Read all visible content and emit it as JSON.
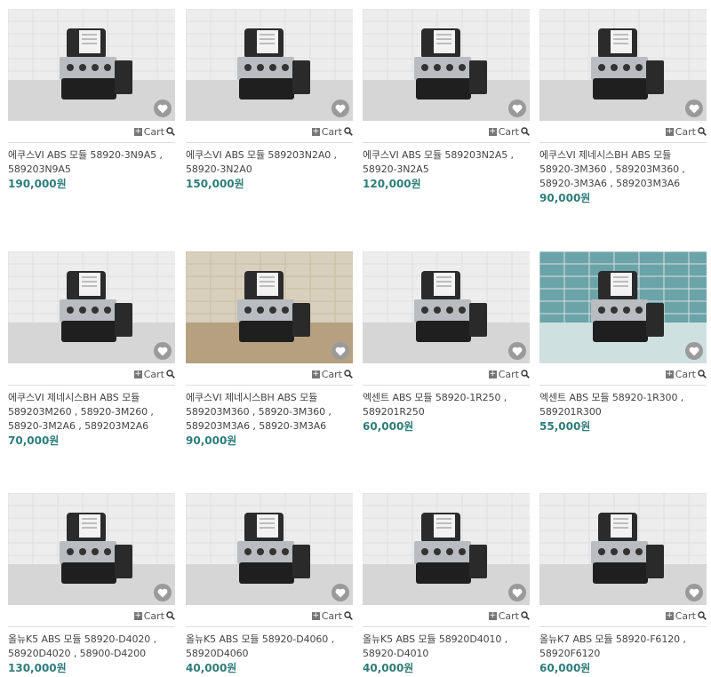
{
  "cart_label": "Cart",
  "products": [
    {
      "title": "에쿠스VI ABS 모듈 58920-3N9A5 , 589203N9A5",
      "price": "190,000원",
      "photo": "plain"
    },
    {
      "title": "에쿠스VI ABS 모듈 589203N2A0 , 58920-3N2A0",
      "price": "150,000원",
      "photo": "plain"
    },
    {
      "title": "에쿠스VI ABS 모듈 589203N2A5 , 58920-3N2A5",
      "price": "120,000원",
      "photo": "plain"
    },
    {
      "title": "에쿠스VI 제네시스BH ABS 모듈 58920-3M360 , 589203M360 , 58920-3M3A6 , 589203M3A6",
      "price": "90,000원",
      "photo": "plain"
    },
    {
      "title": "에쿠스VI 제네시스BH ABS 모듈 589203M260 , 58920-3M260 , 58920-3M2A6 , 589203M2A6",
      "price": "70,000원",
      "photo": "plain"
    },
    {
      "title": "에쿠스VI 제네시스BH ABS 모듈 589203M360 , 58920-3M360 , 589203M3A6 , 58920-3M3A6",
      "price": "90,000원",
      "photo": "warm"
    },
    {
      "title": "엑센트 ABS 모듈 58920-1R250 , 589201R250",
      "price": "60,000원",
      "photo": "plain"
    },
    {
      "title": "엑센트 ABS 모듈 58920-1R300 , 589201R300",
      "price": "55,000원",
      "photo": "teal"
    },
    {
      "title": "올뉴K5 ABS 모듈 58920-D4020 , 58920D4020 , 58900-D4200",
      "price": "130,000원",
      "photo": "plain"
    },
    {
      "title": "올뉴K5 ABS 모듈 58920-D4060 , 58920D4060",
      "price": "40,000원",
      "photo": "plain"
    },
    {
      "title": "올뉴K5 ABS 모듈 58920D4010 , 58920-D4010",
      "price": "40,000원",
      "photo": "plain"
    },
    {
      "title": "올뉴K7 ABS 모듈 58920-F6120 , 58920F6120",
      "price": "60,000원",
      "photo": "plain"
    }
  ],
  "colors": {
    "price": "#2e7d7a",
    "heart_bg": "#9a9a9a"
  },
  "icons": {
    "heart": "heart-icon",
    "magnifier": "magnifier-icon",
    "plus": "plus-icon"
  }
}
